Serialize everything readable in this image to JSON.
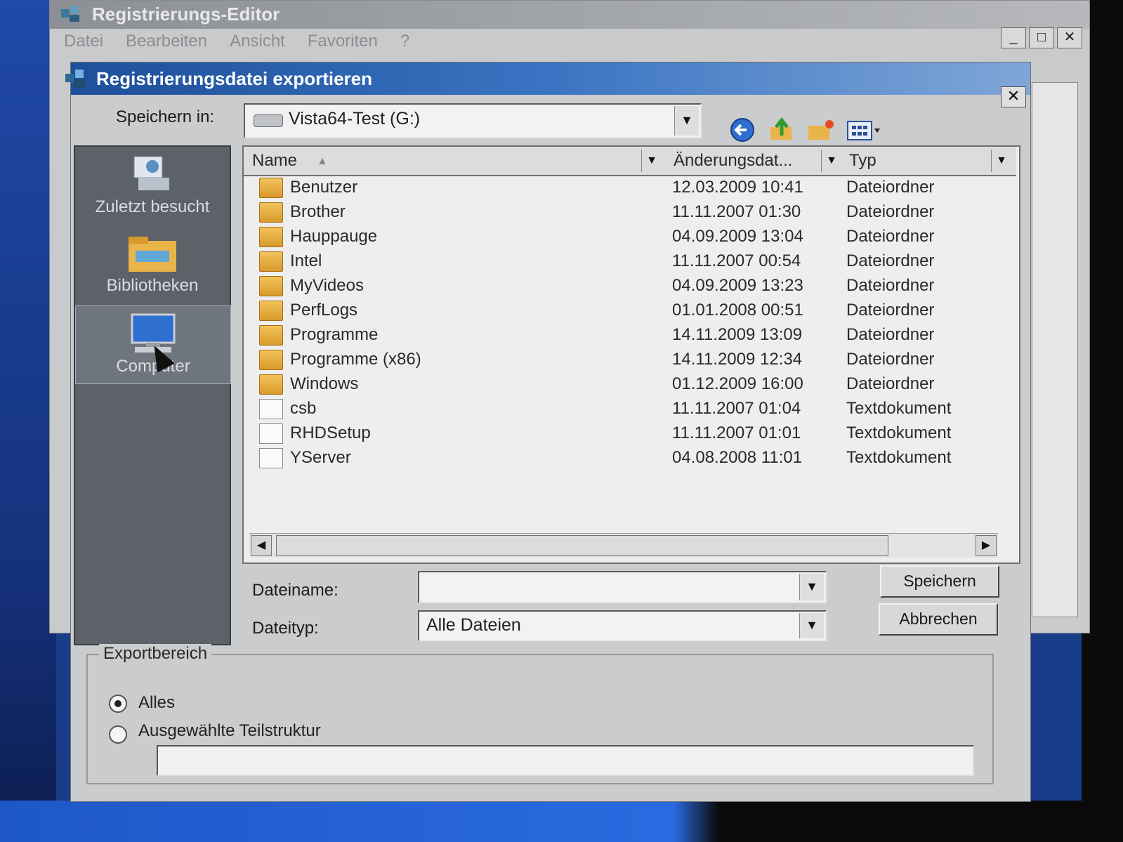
{
  "regedit": {
    "title": "Registrierungs-Editor",
    "menu": [
      "Datei",
      "Bearbeiten",
      "Ansicht",
      "Favoriten",
      "?"
    ],
    "buttons": {
      "minimize": "_",
      "maximize": "□",
      "close": "✕"
    }
  },
  "dialog": {
    "title": "Registrierungsdatei exportieren",
    "close": "✕",
    "save_in_label": "Speichern in:",
    "save_in_value": "Vista64-Test (G:)",
    "places": [
      "Zuletzt besucht",
      "Bibliotheken",
      "Computer"
    ],
    "columns": {
      "name": "Name",
      "date": "Änderungsdat...",
      "type": "Typ"
    },
    "files": [
      {
        "name": "Benutzer",
        "date": "12.03.2009 10:41",
        "type": "Dateiordner",
        "kind": "folder"
      },
      {
        "name": "Brother",
        "date": "11.11.2007 01:30",
        "type": "Dateiordner",
        "kind": "folder"
      },
      {
        "name": "Hauppauge",
        "date": "04.09.2009 13:04",
        "type": "Dateiordner",
        "kind": "folder"
      },
      {
        "name": "Intel",
        "date": "11.11.2007 00:54",
        "type": "Dateiordner",
        "kind": "folder"
      },
      {
        "name": "MyVideos",
        "date": "04.09.2009 13:23",
        "type": "Dateiordner",
        "kind": "folder"
      },
      {
        "name": "PerfLogs",
        "date": "01.01.2008 00:51",
        "type": "Dateiordner",
        "kind": "folder"
      },
      {
        "name": "Programme",
        "date": "14.11.2009 13:09",
        "type": "Dateiordner",
        "kind": "folder"
      },
      {
        "name": "Programme (x86)",
        "date": "14.11.2009 12:34",
        "type": "Dateiordner",
        "kind": "folder"
      },
      {
        "name": "Windows",
        "date": "01.12.2009 16:00",
        "type": "Dateiordner",
        "kind": "folder"
      },
      {
        "name": "csb",
        "date": "11.11.2007 01:04",
        "type": "Textdokument",
        "kind": "doc"
      },
      {
        "name": "RHDSetup",
        "date": "11.11.2007 01:01",
        "type": "Textdokument",
        "kind": "doc"
      },
      {
        "name": "YServer",
        "date": "04.08.2008 11:01",
        "type": "Textdokument",
        "kind": "doc"
      }
    ],
    "filename_label": "Dateiname:",
    "filename_value": "",
    "filetype_label": "Dateityp:",
    "filetype_value": "Alle Dateien",
    "save_button": "Speichern",
    "cancel_button": "Abbrechen",
    "export_range": {
      "legend": "Exportbereich",
      "all": "Alles",
      "selected": "Ausgewählte Teilstruktur",
      "selected_value": ""
    }
  }
}
